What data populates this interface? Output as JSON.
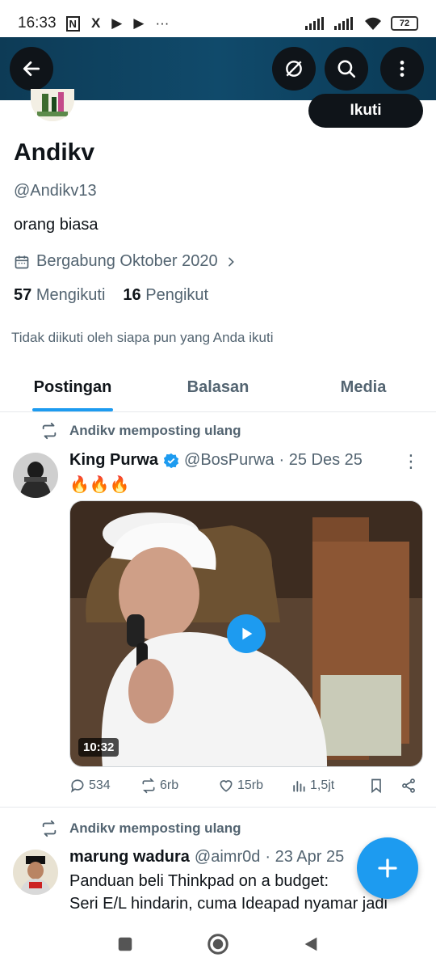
{
  "status_bar": {
    "time": "16:33",
    "notif_icons": [
      "N",
      "X",
      "▶",
      "▶",
      "···"
    ],
    "battery": "72"
  },
  "header": {
    "back_icon": "arrow-left-icon",
    "grok_icon": "grok-icon",
    "search_icon": "search-icon",
    "more_icon": "more-vertical-icon"
  },
  "profile": {
    "follow_label": "Ikuti",
    "name": "Andikv",
    "handle": "@Andikv13",
    "bio": "orang biasa",
    "joined": "Bergabung Oktober 2020",
    "following_count": "57",
    "following_label": "Mengikuti",
    "followers_count": "16",
    "followers_label": "Pengikut",
    "not_followed": "Tidak diikuti oleh siapa pun yang Anda ikuti"
  },
  "tabs": [
    {
      "label": "Postingan",
      "active": true
    },
    {
      "label": "Balasan",
      "active": false
    },
    {
      "label": "Media",
      "active": false
    }
  ],
  "posts": [
    {
      "repost_label": "Andikv memposting ulang",
      "author_name": "King Purwa",
      "author_handle": "@BosPurwa",
      "date": "· 25 Des 25",
      "text": "🔥🔥🔥",
      "video_duration": "10:32",
      "replies": "534",
      "reposts": "6rb",
      "likes": "15rb",
      "views": "1,5jt"
    },
    {
      "repost_label": "Andikv memposting ulang",
      "author_name": "marung wadura",
      "author_handle": "@aimr0d",
      "date": "· 23 Apr 25",
      "text_line1": "Panduan beli Thinkpad on a budget:",
      "text_line2": "Seri E/L hindarin, cuma Ideapad nyamar jadi"
    }
  ],
  "colors": {
    "accent": "#1d9bf0",
    "text": "#0f1419",
    "muted": "#536471",
    "banner": "#104a6b"
  }
}
